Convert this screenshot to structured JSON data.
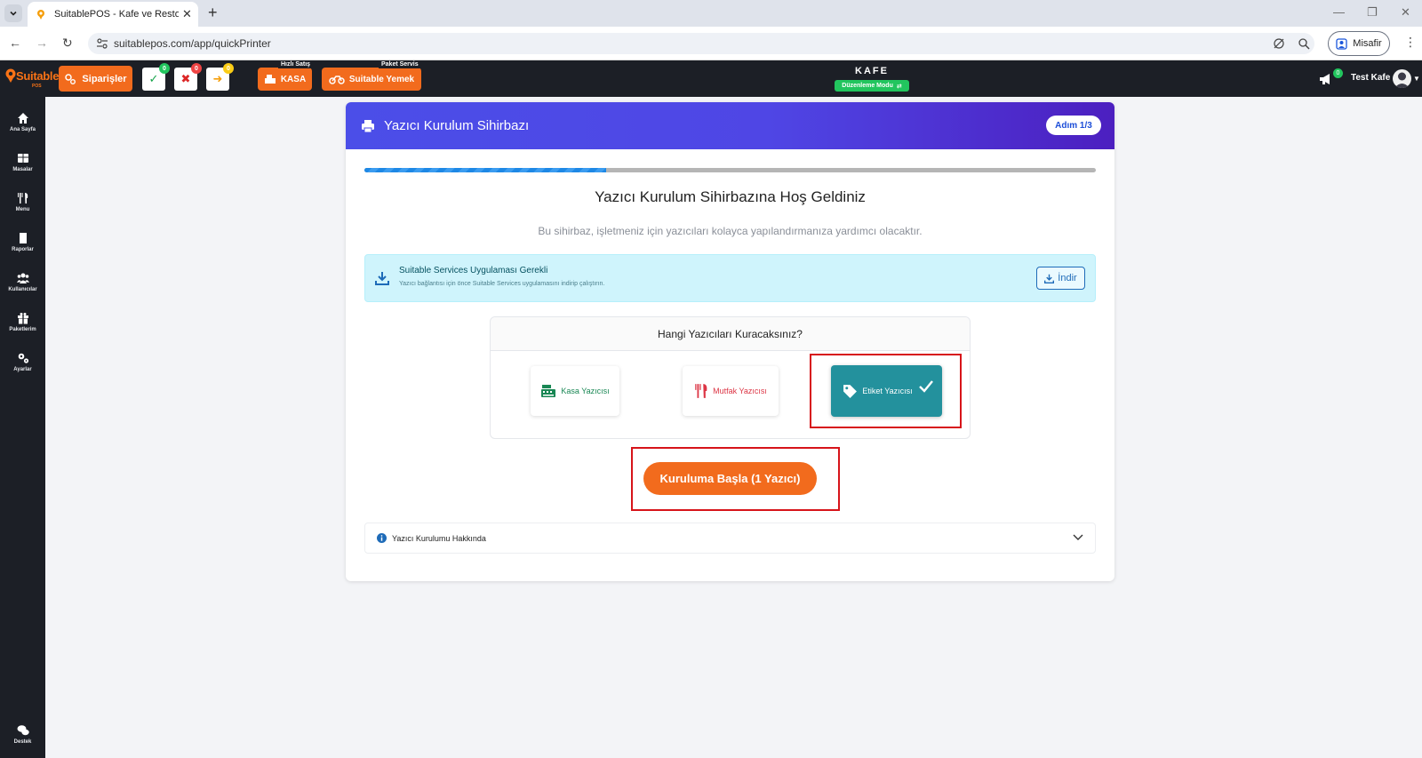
{
  "browser": {
    "tab_title": "SuitablePOS - Kafe ve Restoran",
    "url": "suitablepos.com/app/quickPrinter",
    "profile_label": "Misafir"
  },
  "topbar": {
    "logo_text": "Suitable",
    "logo_sub": "POS",
    "orders_label": "Siparişler",
    "approved_count": "0",
    "rejected_count": "0",
    "forward_count": "0",
    "quick_sale_tag": "Hızlı Satış",
    "quick_sale_label": "KASA",
    "package_tag": "Paket Servis",
    "package_label": "Suitable Yemek",
    "center_title": "KAFE",
    "edit_mode_label": "Düzenleme Modu",
    "notification_count": "0",
    "user_name": "Test Kafe"
  },
  "sidebar": {
    "items": [
      {
        "label": "Ana Sayfa",
        "icon": "home-icon"
      },
      {
        "label": "Masalar",
        "icon": "table-icon"
      },
      {
        "label": "Menu",
        "icon": "utensils-icon"
      },
      {
        "label": "Raporlar",
        "icon": "report-icon"
      },
      {
        "label": "Kullanıcılar",
        "icon": "users-icon"
      },
      {
        "label": "Paketlerim",
        "icon": "gift-icon"
      },
      {
        "label": "Ayarlar",
        "icon": "cogs-icon"
      }
    ],
    "support_label": "Destek"
  },
  "wizard": {
    "header_title": "Yazıcı Kurulum Sihirbazı",
    "step_badge": "Adım 1/3",
    "progress_percent": 33,
    "title": "Yazıcı Kurulum Sihirbazına Hoş Geldiniz",
    "subtitle": "Bu sihirbaz, işletmeniz için yazıcıları kolayca yapılandırmanıza yardımcı olacaktır.",
    "alert_title": "Suitable Services Uygulaması Gerekli",
    "alert_text": "Yazıcı bağlantısı için önce Suitable Services uygulamasını indirip çalıştırın.",
    "download_label": "İndir",
    "question": "Hangi Yazıcıları Kuracaksınız?",
    "printers": [
      {
        "label": "Kasa Yazıcısı",
        "selected": false,
        "color": "#198754"
      },
      {
        "label": "Mutfak Yazıcısı",
        "selected": false,
        "color": "#dc3545"
      },
      {
        "label": "Etiket Yazıcısı",
        "selected": true,
        "color": "#23919d"
      }
    ],
    "start_label": "Kuruluma Başla (1 Yazıcı)",
    "accordion_label": "Yazıcı Kurulumu Hakkında"
  },
  "colors": {
    "accent_orange": "#f26b1d",
    "header_gradient_start": "#4b4ee8",
    "header_gradient_end": "#4c1fc0",
    "highlight_red": "#d7141a",
    "dark_bar": "#1c1f26"
  }
}
